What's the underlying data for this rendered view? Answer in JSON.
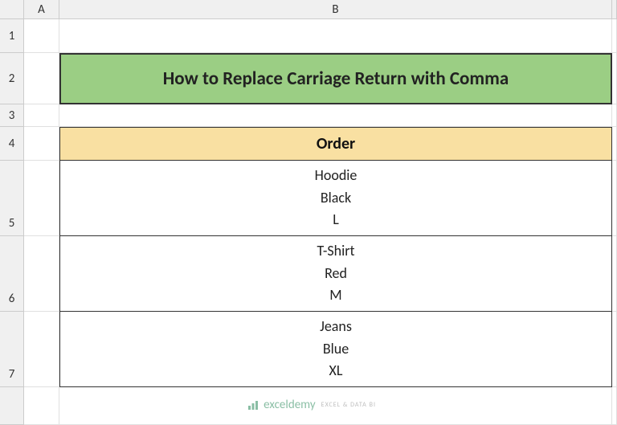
{
  "columns": [
    "A",
    "B"
  ],
  "rows": [
    "1",
    "2",
    "3",
    "4",
    "5",
    "6",
    "7"
  ],
  "title": "How to Replace Carriage Return with Comma",
  "table": {
    "header": "Order",
    "rows": [
      {
        "line1": "Hoodie",
        "line2": "Black",
        "line3": "L"
      },
      {
        "line1": "T-Shirt",
        "line2": "Red",
        "line3": "M"
      },
      {
        "line1": "Jeans",
        "line2": "Blue",
        "line3": "XL"
      }
    ]
  },
  "watermark": {
    "brand": "exceldemy",
    "tag": "EXCEL & DATA BI"
  }
}
